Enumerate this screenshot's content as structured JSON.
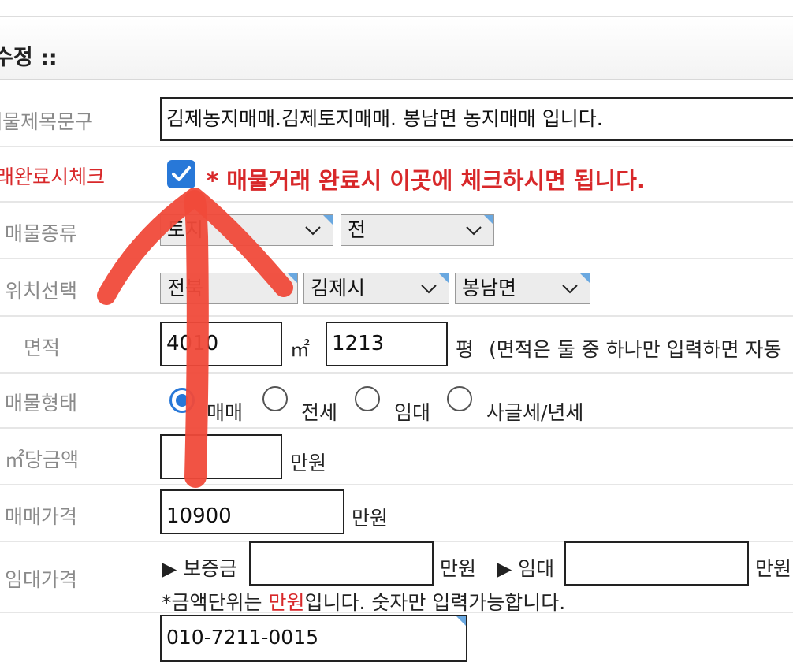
{
  "header": {
    "title": "수정 ::"
  },
  "rows": {
    "title_phrase": {
      "label": "매물제목문구",
      "value": "김제농지매매.김제토지매매. 봉남면 농지매매 입니다."
    },
    "completion": {
      "label": "거래완료시체크",
      "checked": true,
      "notice": "* 매물거래 완료시 이곳에 체크하시면 됩니다."
    },
    "property_type": {
      "label": "매물종류",
      "select1": "토지",
      "select2": "전"
    },
    "location": {
      "label": "위치선택",
      "select1": "전북",
      "select2": "김제시",
      "select3": "봉남면"
    },
    "area": {
      "label": "면적",
      "sqm_value": "4010",
      "sqm_unit": "㎡",
      "pyeong_value": "1213",
      "pyeong_unit": "평",
      "note": "(면적은 둘 중 하나만 입력하면 자동"
    },
    "deal_type": {
      "label": "매물형태",
      "options": [
        "매매",
        "전세",
        "임대",
        "사글세/년세"
      ],
      "selected": "매매"
    },
    "price_per_sqm": {
      "label": "㎡당금액",
      "value": "",
      "unit": "만원"
    },
    "sale_price": {
      "label": "매매가격",
      "value": "10900",
      "unit": "만원"
    },
    "rent_price": {
      "label": "임대가격",
      "deposit_label": "▶ 보증금",
      "deposit_value": "",
      "deposit_unit": "만원",
      "rent_label": "▶ 임대",
      "rent_value": "",
      "rent_unit": "만원",
      "note_prefix": "*금액단위는 ",
      "note_highlight": "만원",
      "note_suffix": "입니다. 숫자만 입력가능합니다."
    },
    "contact": {
      "value": "010-7211-0015"
    }
  },
  "colors": {
    "accent_red": "#d8282a",
    "accent_blue": "#2878d8",
    "annotation_arrow": "#f04a3a"
  },
  "icons": {
    "checkbox": "checkmark-icon",
    "select": "chevron-down-icon",
    "annotation": "hand-drawn-arrow-up"
  }
}
